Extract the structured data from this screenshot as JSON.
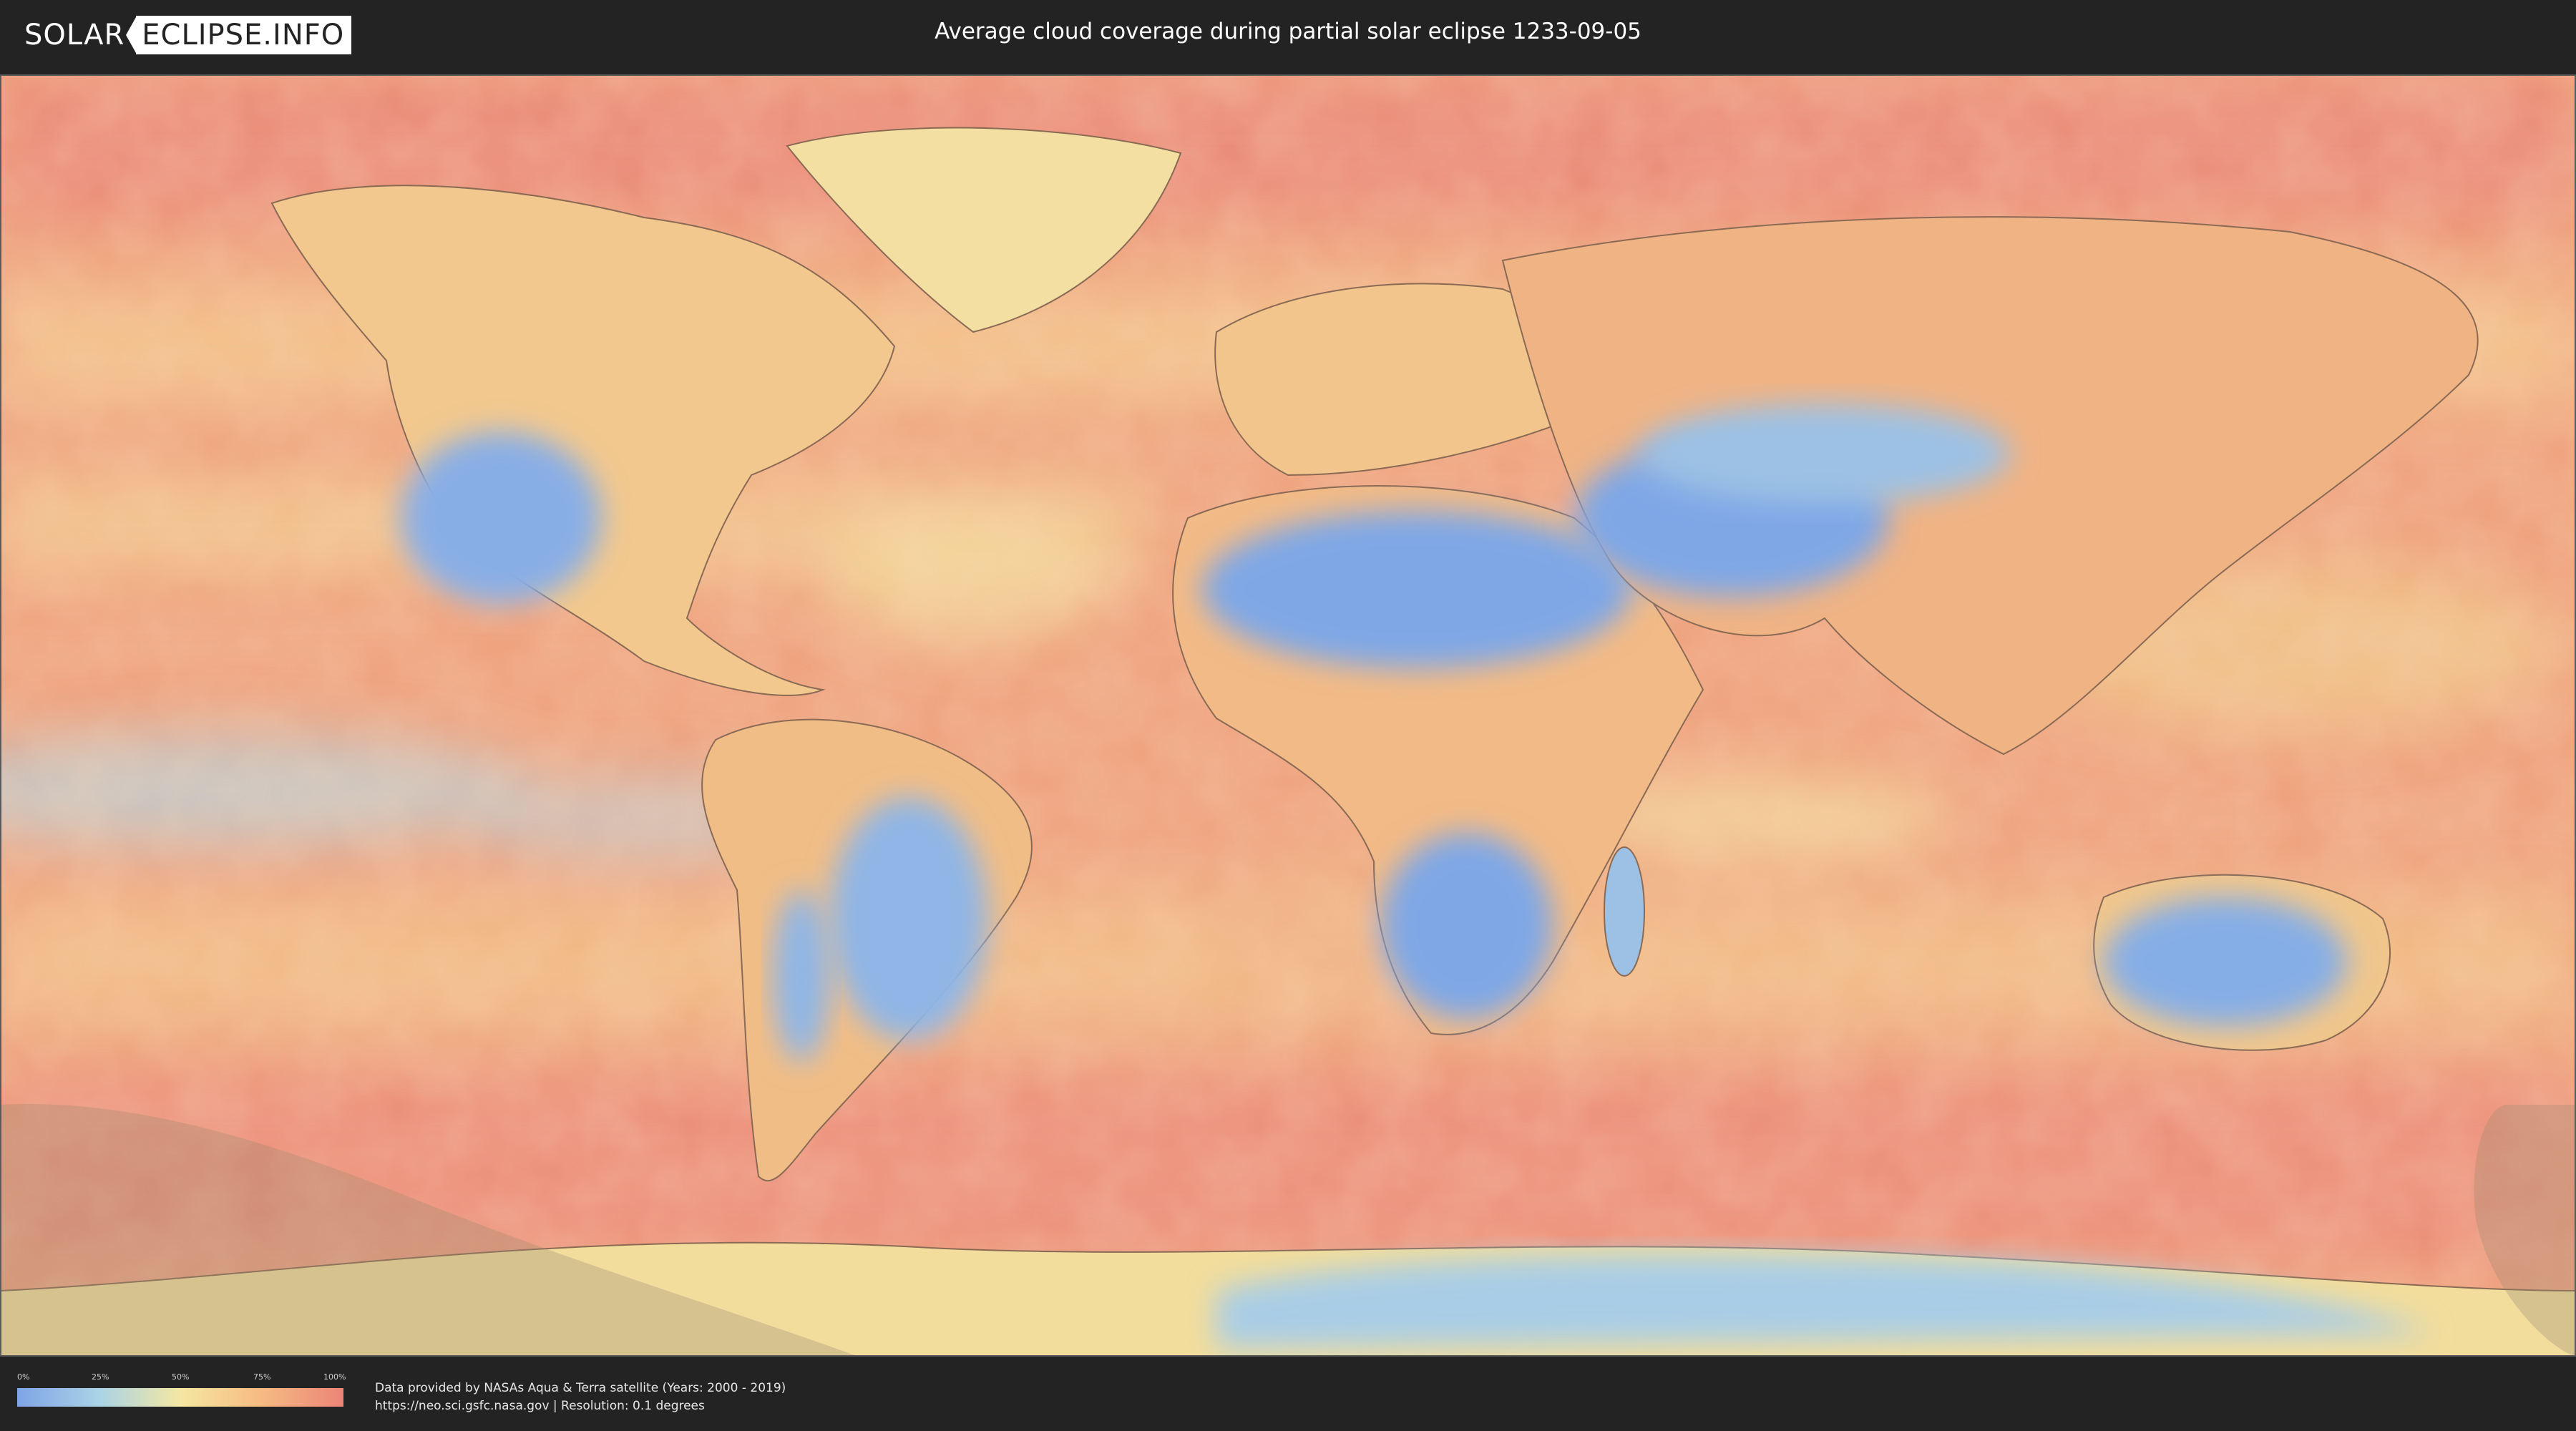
{
  "header": {
    "logo_part1": "SOLAR",
    "logo_part2": "ECLIPSE.INFO",
    "title": "Average cloud coverage during partial solar eclipse 1233-09-05"
  },
  "legend": {
    "ticks": [
      "0%",
      "25%",
      "50%",
      "75%",
      "100%"
    ],
    "colors": [
      "#7fa4e6",
      "#a9d3e6",
      "#f4e7a2",
      "#f6ba82",
      "#ec8477"
    ]
  },
  "credits": {
    "line1": "Data provided by NASAs Aqua & Terra satellite (Years: 2000 - 2019)",
    "line2": "https://neo.sci.gsfc.nasa.gov | Resolution: 0.1 degrees"
  },
  "map": {
    "palette": {
      "ocean_high": "#ec8a78",
      "ocean_mid": "#f3b886",
      "dry_land": "#86aee6",
      "mid_cover": "#f2de9e",
      "coast_line": "#8a6a55",
      "eclipse_shade": "#9a8a70"
    }
  }
}
